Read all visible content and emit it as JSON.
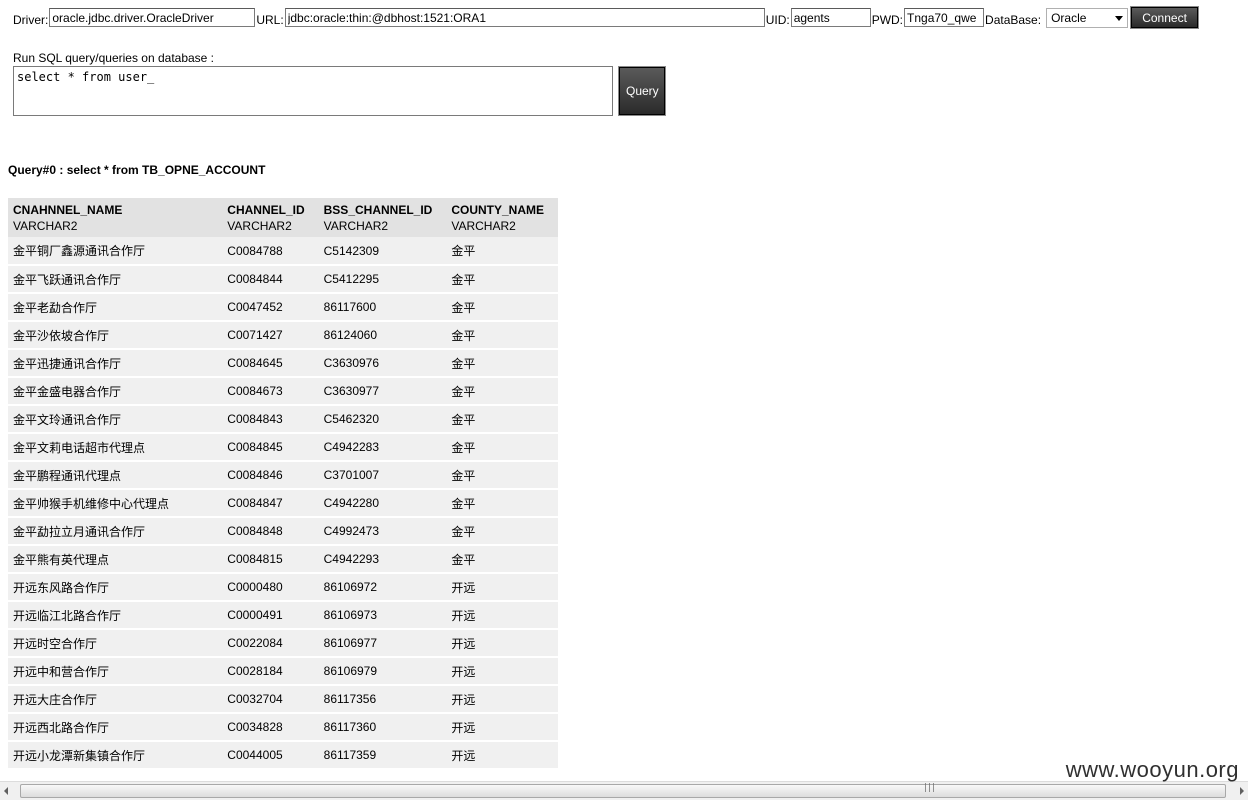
{
  "connection": {
    "driver_label": "Driver:",
    "driver_value": "oracle.jdbc.driver.OracleDriver",
    "url_label": "URL:",
    "url_value": "jdbc:oracle:thin:@dbhost:1521:ORA1",
    "uid_label": "UID:",
    "uid_value": "agents",
    "pwd_label": "PWD:",
    "pwd_value": "Tnga70_qwe",
    "database_label": "DataBase:",
    "database_selected": "Oracle",
    "connect_label": "Connect"
  },
  "query_editor": {
    "label": "Run SQL query/queries on database :",
    "sql_text": "select * from user_",
    "query_button_label": "Query"
  },
  "result": {
    "title": "Query#0 : select * from TB_OPNE_ACCOUNT",
    "columns": [
      {
        "name": "CNAHNNEL_NAME",
        "type": "VARCHAR2"
      },
      {
        "name": "CHANNEL_ID",
        "type": "VARCHAR2"
      },
      {
        "name": "BSS_CHANNEL_ID",
        "type": "VARCHAR2"
      },
      {
        "name": "COUNTY_NAME",
        "type": "VARCHAR2"
      }
    ],
    "rows": [
      [
        "金平铜厂鑫源通讯合作厅",
        "C0084788",
        "C5142309",
        "金平"
      ],
      [
        "金平飞跃通讯合作厅",
        "C0084844",
        "C5412295",
        "金平"
      ],
      [
        "金平老勐合作厅",
        "C0047452",
        "86117600",
        "金平"
      ],
      [
        "金平沙依坡合作厅",
        "C0071427",
        "86124060",
        "金平"
      ],
      [
        "金平迅捷通讯合作厅",
        "C0084645",
        "C3630976",
        "金平"
      ],
      [
        "金平金盛电器合作厅",
        "C0084673",
        "C3630977",
        "金平"
      ],
      [
        "金平文玲通讯合作厅",
        "C0084843",
        "C5462320",
        "金平"
      ],
      [
        "金平文莉电话超市代理点",
        "C0084845",
        "C4942283",
        "金平"
      ],
      [
        "金平鹏程通讯代理点",
        "C0084846",
        "C3701007",
        "金平"
      ],
      [
        "金平帅猴手机维修中心代理点",
        "C0084847",
        "C4942280",
        "金平"
      ],
      [
        "金平勐拉立月通讯合作厅",
        "C0084848",
        "C4992473",
        "金平"
      ],
      [
        "金平熊有英代理点",
        "C0084815",
        "C4942293",
        "金平"
      ],
      [
        "开远东风路合作厅",
        "C0000480",
        "86106972",
        "开远"
      ],
      [
        "开远临江北路合作厅",
        "C0000491",
        "86106973",
        "开远"
      ],
      [
        "开远时空合作厅",
        "C0022084",
        "86106977",
        "开远"
      ],
      [
        "开远中和营合作厅",
        "C0028184",
        "86106979",
        "开远"
      ],
      [
        "开远大庄合作厅",
        "C0032704",
        "86117356",
        "开远"
      ],
      [
        "开远西北路合作厅",
        "C0034828",
        "86117360",
        "开远"
      ],
      [
        "开远小龙潭新集镇合作厅",
        "C0044005",
        "86117359",
        "开远"
      ]
    ]
  },
  "watermark": "www.wooyun.org"
}
